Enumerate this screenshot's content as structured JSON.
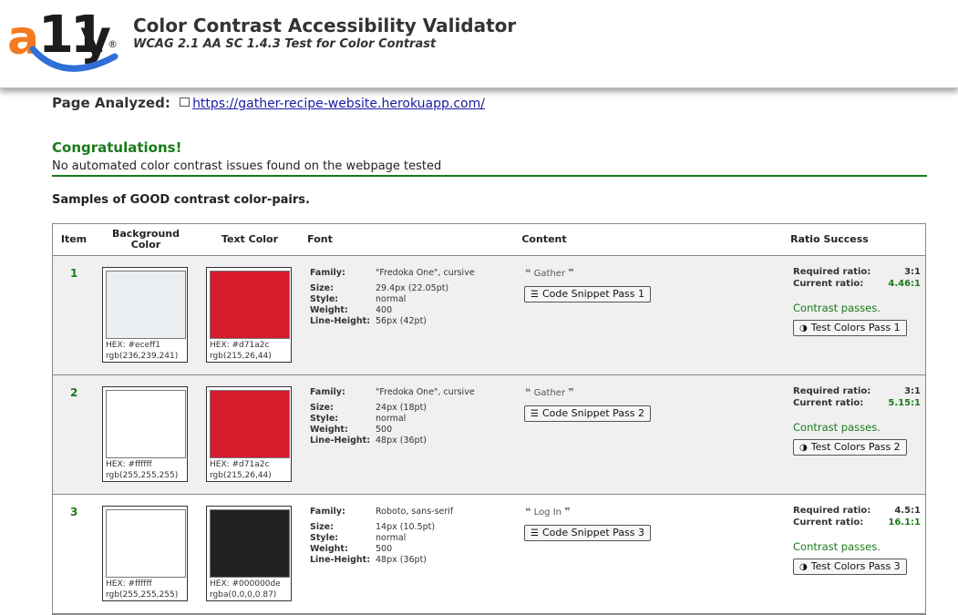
{
  "app": {
    "logo_a": "a",
    "logo_11": "11",
    "logo_y": "y",
    "logo_reg": "®",
    "title": "Color Contrast Accessibility Validator",
    "subtitle": "WCAG 2.1 AA SC 1.4.3 Test for Color Contrast"
  },
  "page": {
    "label": "Page Analyzed:",
    "url": "https://gather-recipe-website.herokuapp.com/"
  },
  "result": {
    "title": "Congratulations!",
    "message": "No automated color contrast issues found on the webpage tested"
  },
  "samples_title": "Samples of GOOD contrast color-pairs.",
  "table": {
    "headers": {
      "item": "Item",
      "background": "Background Color",
      "text_color": "Text Color",
      "font": "Font",
      "content": "Content",
      "ratio": "Ratio Success"
    },
    "font_labels": {
      "family": "Family:",
      "size": "Size:",
      "style": "Style:",
      "weight": "Weight:",
      "line_height": "Line-Height:"
    },
    "ratio_labels": {
      "required": "Required ratio:",
      "current": "Current ratio:"
    },
    "rows": [
      {
        "item": "1",
        "bg_hex": "HEX: #eceff1",
        "bg_rgb": "rgb(236,239,241)",
        "bg_color": "#eceff1",
        "fg_hex": "HEX: #d71a2c",
        "fg_rgb": "rgb(215,26,44)",
        "fg_color": "#d71a2c",
        "family": "\"Fredoka One\", cursive",
        "size": "29.4px (22.05pt)",
        "style": "normal",
        "weight": "400",
        "line_height": "56px (42pt)",
        "content": "Gather",
        "snippet_button": "Code Snippet Pass 1",
        "required_ratio": "3:1",
        "current_ratio": "4.46:1",
        "pass_text": "Contrast passes.",
        "test_button": "Test Colors Pass 1"
      },
      {
        "item": "2",
        "bg_hex": "HEX: #ffffff",
        "bg_rgb": "rgb(255,255,255)",
        "bg_color": "#ffffff",
        "fg_hex": "HEX: #d71a2c",
        "fg_rgb": "rgb(215,26,44)",
        "fg_color": "#d71a2c",
        "family": "\"Fredoka One\", cursive",
        "size": "24px (18pt)",
        "style": "normal",
        "weight": "500",
        "line_height": "48px (36pt)",
        "content": "Gather",
        "snippet_button": "Code Snippet Pass 2",
        "required_ratio": "3:1",
        "current_ratio": "5.15:1",
        "pass_text": "Contrast passes.",
        "test_button": "Test Colors Pass 2"
      },
      {
        "item": "3",
        "bg_hex": "HEX: #ffffff",
        "bg_rgb": "rgb(255,255,255)",
        "bg_color": "#ffffff",
        "fg_hex": "HEX: #000000de",
        "fg_rgb": "rgba(0,0,0,0.87)",
        "fg_color": "#212121",
        "family": "Roboto, sans-serif",
        "size": "14px (10.5pt)",
        "style": "normal",
        "weight": "500",
        "line_height": "48px (36pt)",
        "content": "Log In",
        "snippet_button": "Code Snippet Pass 3",
        "required_ratio": "4.5:1",
        "current_ratio": "16.1:1",
        "pass_text": "Contrast passes.",
        "test_button": "Test Colors Pass 3"
      }
    ]
  }
}
